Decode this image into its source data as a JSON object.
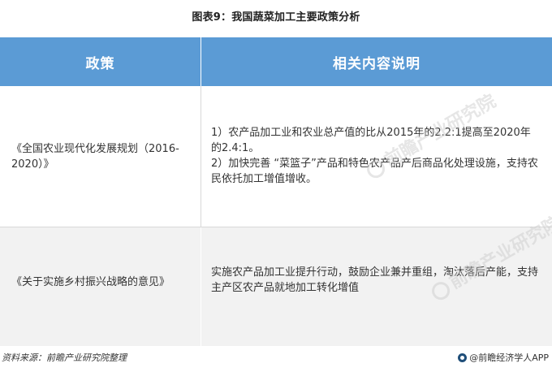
{
  "page": {
    "title": "图表9：我国蔬菜加工主要政策分析"
  },
  "table": {
    "headers": {
      "policy": "政策",
      "description": "相关内容说明"
    },
    "rows": [
      {
        "policy": "《全国农业现代化发展规划（2016-2020）》",
        "description_lines": [
          "1）农产品加工业和农业总产值的比从2015年的2.2:1提高至2020年的2.4:1。",
          "2）加快完善 “菜篮子”产品和特色农产品产后商品化处理设施，支持农民依托加工增值增收。"
        ]
      },
      {
        "policy": "《关于实施乡村振兴战略的意见》",
        "description_lines": [
          "实施农产品加工业提升行动，鼓励企业兼并重组，淘汰落后产能，支持主产区农产品就地加工转化增值"
        ]
      }
    ]
  },
  "watermark": {
    "text": "前瞻产业研究院"
  },
  "footer": {
    "source": "资料来源：前瞻产业研究院整理",
    "brand": "@前瞻经济学人APP"
  },
  "colors": {
    "header_bg": "#5b9bd5",
    "header_text": "#ffffff",
    "row_alt_bg": "#f2f2f2",
    "brand_icon": "#1f4e79"
  }
}
